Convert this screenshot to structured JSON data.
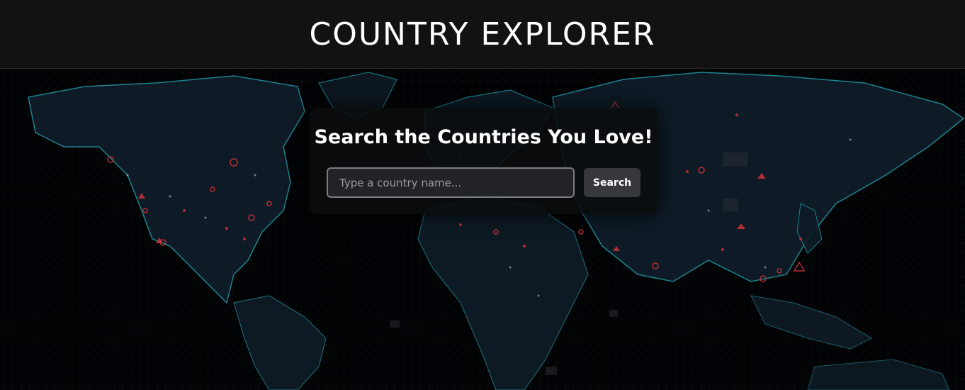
{
  "header": {
    "title": "COUNTRY EXPLORER"
  },
  "search_card": {
    "heading": "Search the Countries You Love!",
    "input": {
      "placeholder": "Type a country name...",
      "value": ""
    },
    "button_label": "Search"
  },
  "background": {
    "description_icon": "world-map-icon",
    "land_color": "#0e1a24",
    "coast_color": "#1f8a96",
    "marker_color": "#c8323a"
  }
}
